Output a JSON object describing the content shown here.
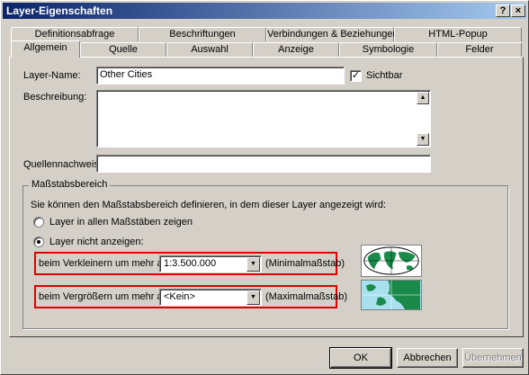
{
  "window": {
    "title": "Layer-Eigenschaften",
    "help_label": "?",
    "close_label": "×"
  },
  "tabs": {
    "row_back": [
      "Definitionsabfrage",
      "Beschriftungen",
      "Verbindungen & Beziehungen",
      "HTML-Popup"
    ],
    "row_front": [
      "Allgemein",
      "Quelle",
      "Auswahl",
      "Anzeige",
      "Symbologie",
      "Felder"
    ],
    "active": "Allgemein"
  },
  "general": {
    "layer_name_label": "Layer-Name:",
    "layer_name_value": "Other Cities",
    "visible_label": "Sichtbar",
    "visible_checked": true,
    "description_label": "Beschreibung:",
    "description_value": "",
    "credits_label": "Quellennachweis:",
    "credits_value": ""
  },
  "scale_range": {
    "group_title": "Maßstabsbereich",
    "intro_text": "Sie können den Maßstabsbereich definieren, in dem dieser Layer angezeigt wird:",
    "option_all": "Layer in allen Maßstäben zeigen",
    "option_limit": "Layer nicht anzeigen:",
    "selected_option": "limit",
    "zoom_out_label": "beim Verkleinern um mehr als:",
    "zoom_out_value": "1:3.500.000",
    "zoom_out_suffix": "(Minimalmaßstab)",
    "zoom_in_label": "beim Vergrößern um mehr als:",
    "zoom_in_value": "<Kein>",
    "zoom_in_suffix": "(Maximalmaßstab)"
  },
  "buttons": {
    "ok": "OK",
    "cancel": "Abbrechen",
    "apply": "Übernehmen"
  },
  "colors": {
    "title_start": "#0a246a",
    "title_end": "#a6caf0",
    "highlight_box": "#e00000",
    "dialog_bg": "#d4d0c8"
  }
}
